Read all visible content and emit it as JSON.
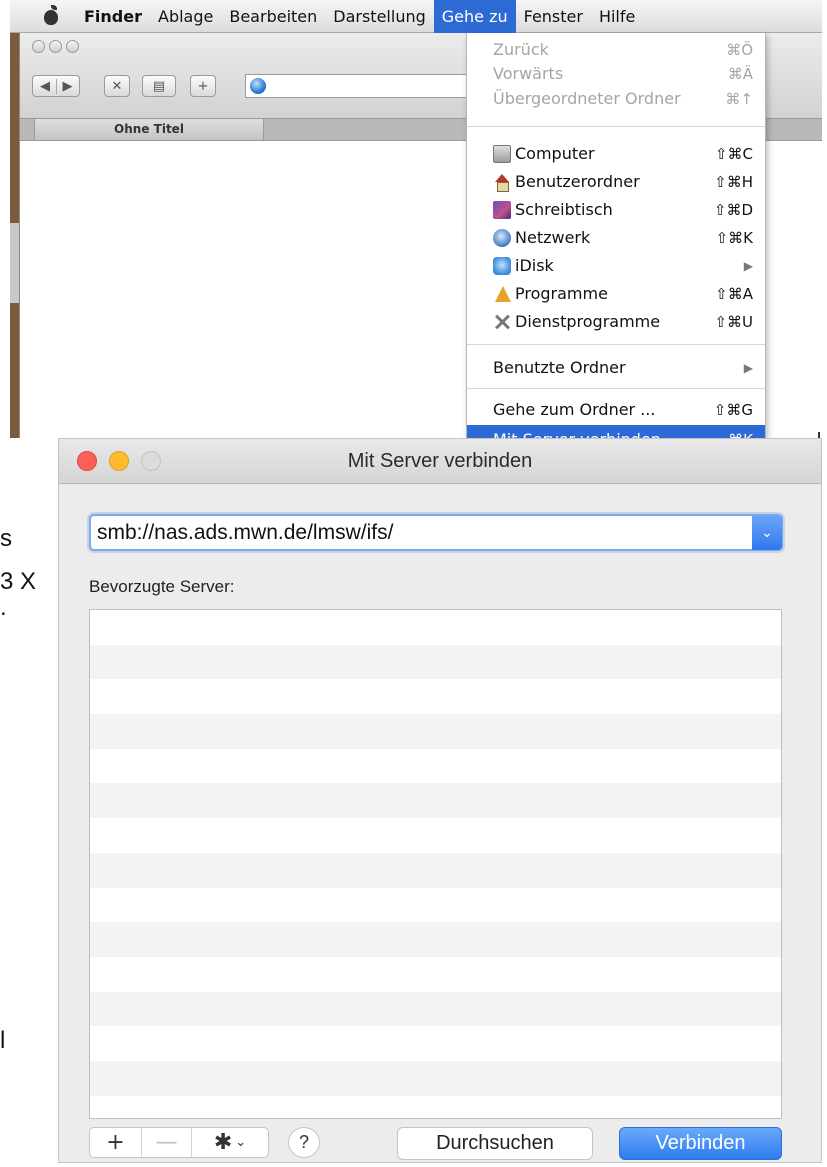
{
  "menubar": {
    "items": [
      {
        "label": "Finder",
        "bold": true
      },
      {
        "label": "Ablage"
      },
      {
        "label": "Bearbeiten"
      },
      {
        "label": "Darstellung"
      },
      {
        "label": "Gehe zu",
        "active": true
      },
      {
        "label": "Fenster"
      },
      {
        "label": "Hilfe"
      }
    ]
  },
  "finder": {
    "tab_label": "Ohne Titel",
    "toolbar": {
      "back": "◀",
      "forward": "▶",
      "close": "✕",
      "plus": "+"
    }
  },
  "go_menu": {
    "items": [
      {
        "label": "Zurück",
        "shortcut": "⌘Ö",
        "disabled": true
      },
      {
        "label": "Vorwärts",
        "shortcut": "⌘Ä",
        "disabled": true
      },
      {
        "label": "Übergeordneter Ordner",
        "shortcut": "⌘↑",
        "disabled": true
      },
      {
        "label": "Computer",
        "shortcut": "⇧⌘C",
        "icon": "computer-icon"
      },
      {
        "label": "Benutzerordner",
        "shortcut": "⇧⌘H",
        "icon": "home-icon"
      },
      {
        "label": "Schreibtisch",
        "shortcut": "⇧⌘D",
        "icon": "desktop-icon"
      },
      {
        "label": "Netzwerk",
        "shortcut": "⇧⌘K",
        "icon": "network-icon"
      },
      {
        "label": "iDisk",
        "submenu": "▶",
        "icon": "idisk-icon"
      },
      {
        "label": "Programme",
        "shortcut": "⇧⌘A",
        "icon": "applications-icon"
      },
      {
        "label": "Dienstprogramme",
        "shortcut": "⇧⌘U",
        "icon": "utilities-icon"
      },
      {
        "label": "Benutzte Ordner",
        "submenu": "▶"
      },
      {
        "label": "Gehe zum Ordner ...",
        "shortcut": "⇧⌘G"
      },
      {
        "label": "Mit Server verbinden ...",
        "shortcut": "⌘K",
        "highlight": true
      }
    ]
  },
  "dialog": {
    "title": "Mit Server verbinden",
    "server_address": "smb://nas.ads.mwn.de/lmsw/ifs/",
    "dropdown_glyph": "⌄",
    "favorites_label": "Bevorzugte Server:",
    "favorites": [],
    "add_glyph": "+",
    "remove_glyph": "—",
    "gear_glyph": "✱",
    "gear_chevron": "⌄",
    "help_glyph": "?",
    "browse_label": "Durchsuchen",
    "connect_label": "Verbinden"
  },
  "background_text": {
    "fragment_1": "s",
    "fragment_2": "3 X",
    "fragment_3": ".",
    "fragment_4": "l"
  },
  "colors": {
    "accent": "#2d6ad6",
    "connect_button": "#2c7bf0",
    "traffic_red": "#fc5f57",
    "traffic_yellow": "#fdbb2f"
  }
}
